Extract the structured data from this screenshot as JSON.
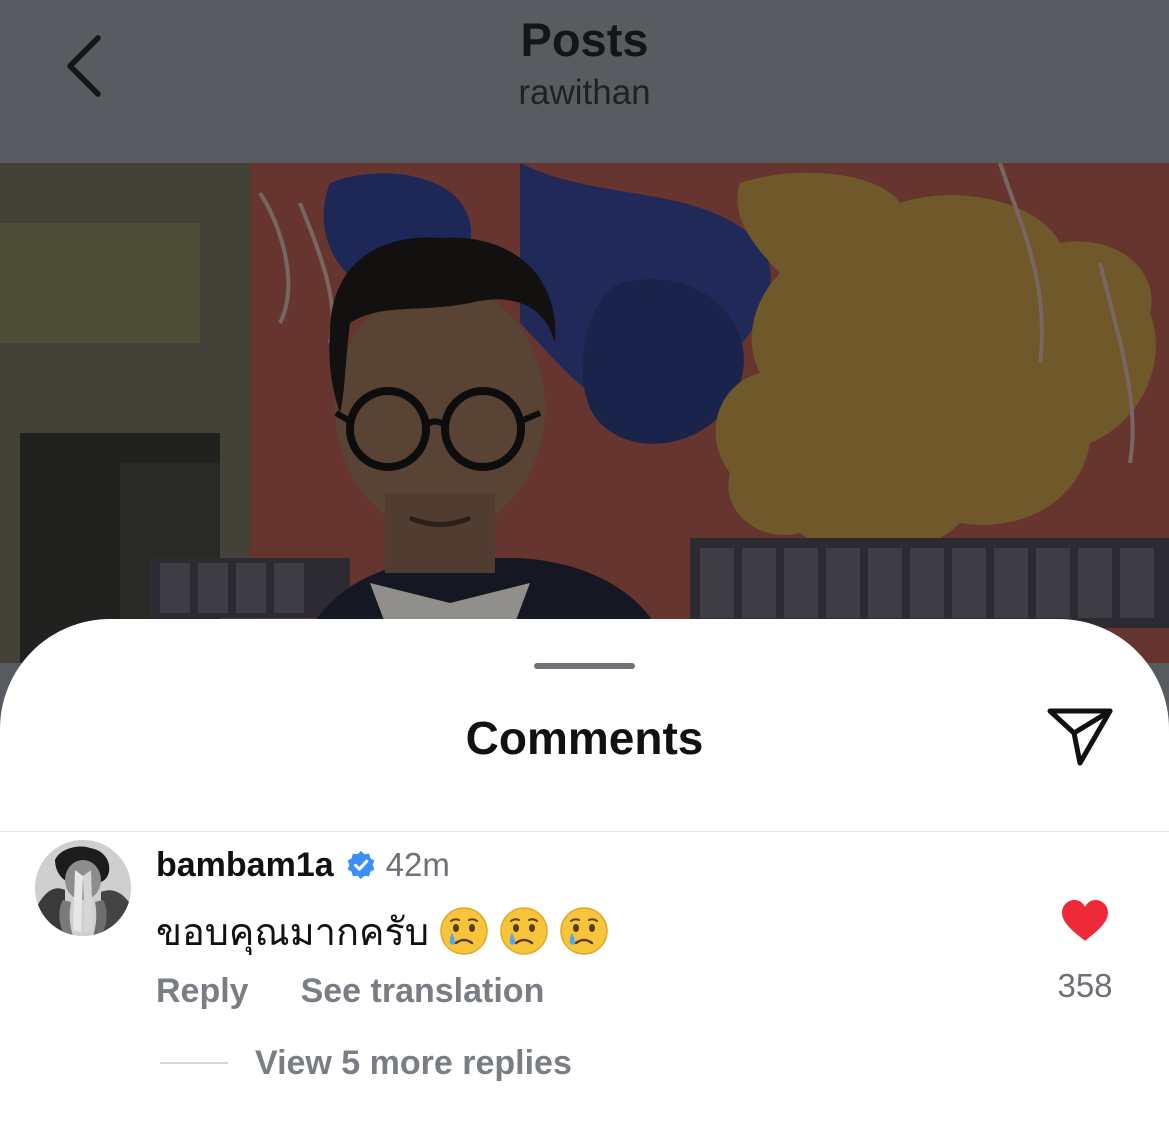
{
  "header": {
    "title": "Posts",
    "subtitle": "rawithan"
  },
  "sheet": {
    "title": "Comments"
  },
  "comment": {
    "username": "bambam1a",
    "verified": true,
    "timestamp": "42m",
    "text": "ขอบคุณมากครับ",
    "emojis": [
      "crying-face",
      "crying-face",
      "crying-face"
    ],
    "actions": {
      "reply": "Reply",
      "translate": "See translation"
    },
    "likes": "358",
    "liked": true,
    "view_replies": "View 5 more replies"
  },
  "icons": {
    "back": "chevron-left-icon",
    "share": "paper-plane-icon",
    "verified": "verified-badge-icon",
    "like": "heart-icon"
  },
  "colors": {
    "verified_blue": "#3b8ff6",
    "like_red": "#ee2a3a",
    "secondary_text": "#7a7e84",
    "overlay_dim": "#585c61"
  }
}
